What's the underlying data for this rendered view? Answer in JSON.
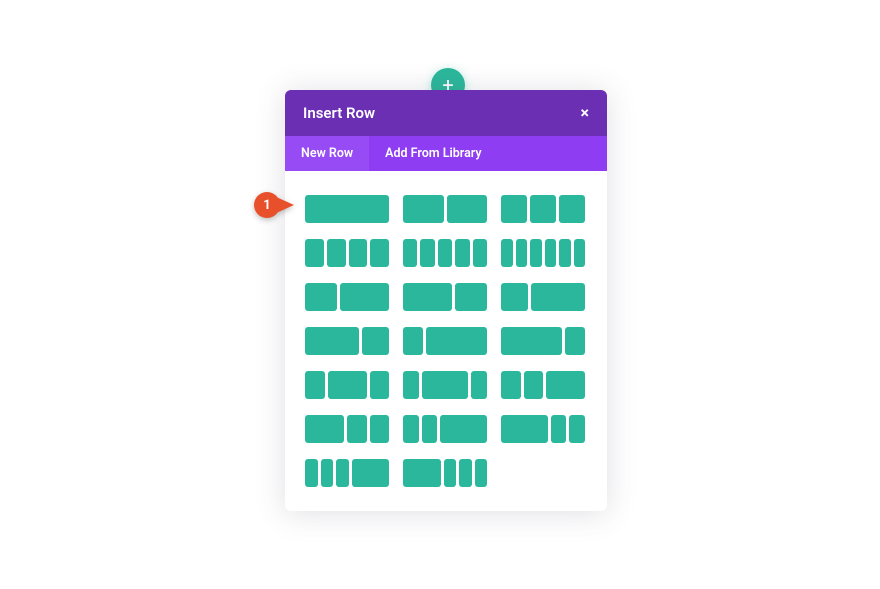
{
  "colors": {
    "teal": "#2bb79b",
    "purple": "#6b2fb3",
    "purpleLight": "#8e3df2",
    "pointer": "#e8502b"
  },
  "addButton": {
    "glyph": "+"
  },
  "modal": {
    "title": "Insert Row",
    "closeGlyph": "×",
    "tabs": {
      "newRow": "New Row",
      "library": "Add From Library"
    }
  },
  "pointer": {
    "number": "1"
  }
}
